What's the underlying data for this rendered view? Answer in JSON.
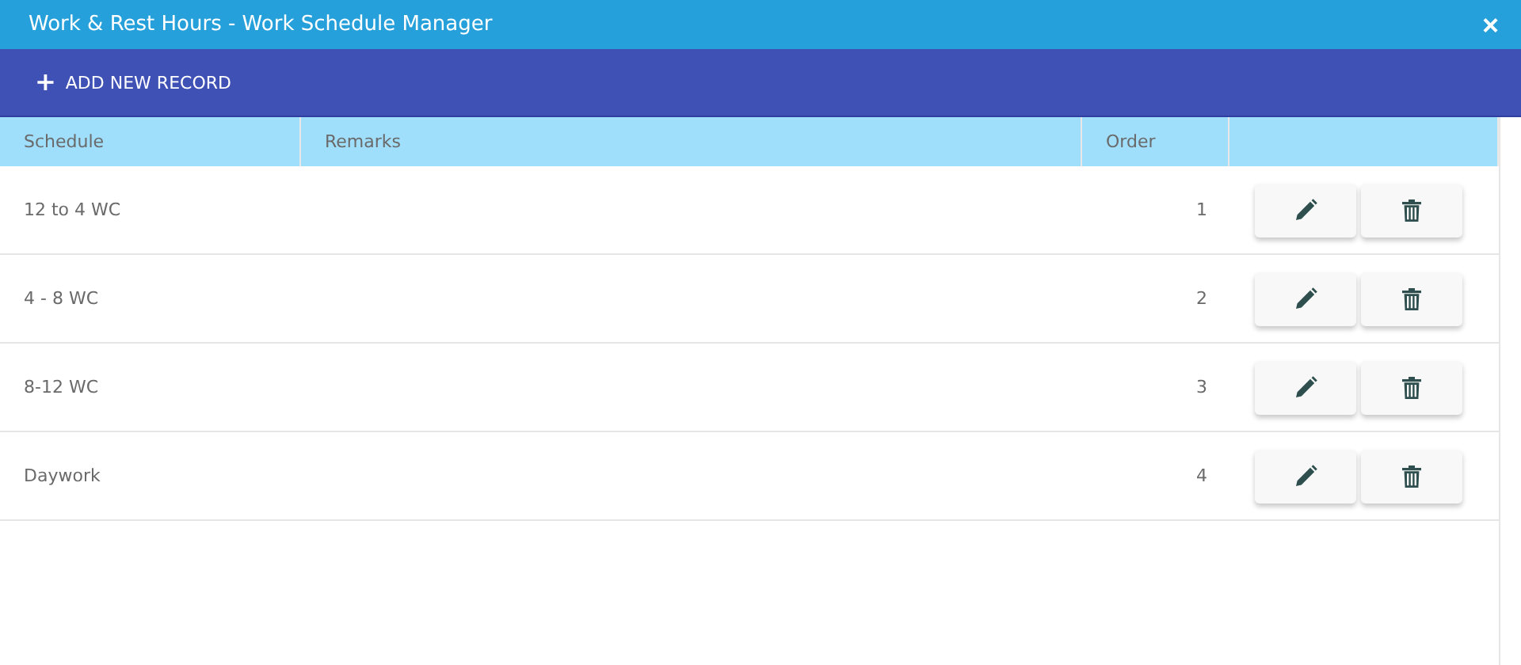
{
  "window": {
    "title": "Work & Rest Hours - Work Schedule Manager",
    "close": "×"
  },
  "toolbar": {
    "add_button": {
      "icon": "+",
      "label": "ADD NEW RECORD"
    }
  },
  "table": {
    "columns": [
      "Schedule",
      "Remarks",
      "Order"
    ],
    "rows": [
      {
        "schedule": "12 to 4 WC",
        "order": "1"
      },
      {
        "schedule": "4 - 8 WC",
        "order": "2"
      },
      {
        "schedule": "8-12 WC",
        "order": "3"
      },
      {
        "schedule": "Daywork",
        "order": "4"
      }
    ]
  }
}
